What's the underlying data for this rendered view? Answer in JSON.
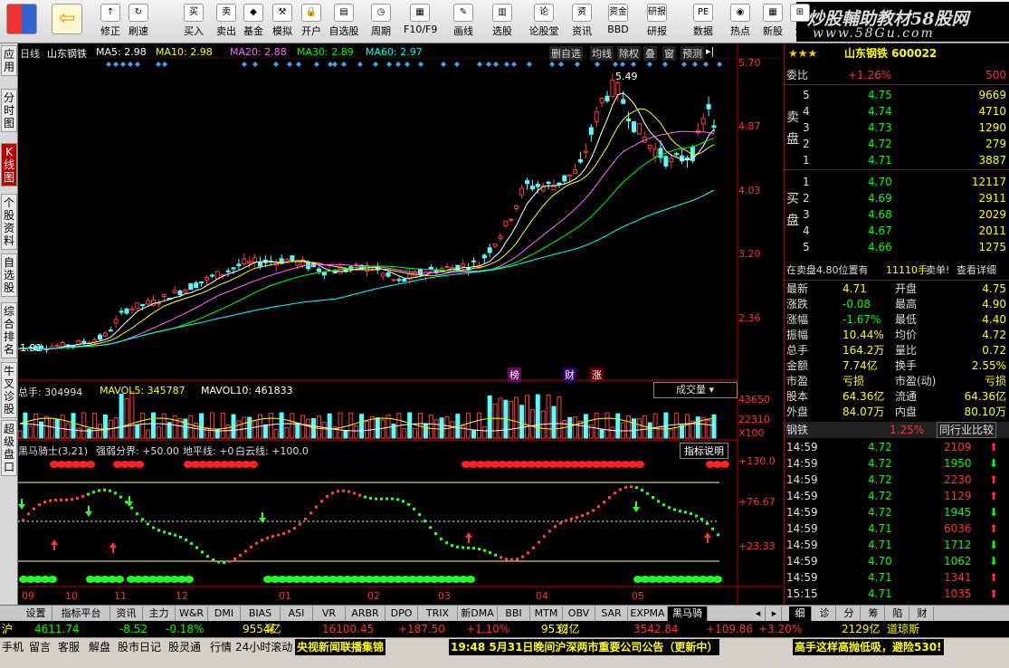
{
  "toolbar": [
    {
      "label": "修正",
      "icon": "↑"
    },
    {
      "label": "刷速",
      "icon": "↻"
    },
    {
      "label": "买入",
      "icon": "买"
    },
    {
      "label": "卖出",
      "icon": "卖"
    },
    {
      "label": "基金",
      "icon": "◆"
    },
    {
      "label": "模拟",
      "icon": "⚒"
    },
    {
      "label": "开户",
      "icon": "🔒"
    },
    {
      "label": "自选股",
      "icon": "▤"
    },
    {
      "label": "周期",
      "icon": "◷"
    },
    {
      "label": "F10/F9",
      "icon": "▦"
    },
    {
      "label": "画线",
      "icon": "✎"
    },
    {
      "label": "选股",
      "icon": "▥"
    },
    {
      "label": "论股堂",
      "icon": "论"
    },
    {
      "label": "资讯",
      "icon": "资"
    },
    {
      "label": "BBD",
      "icon": "资金"
    },
    {
      "label": "研报",
      "icon": "研报"
    },
    {
      "label": "数据",
      "icon": "PE"
    },
    {
      "label": "热点",
      "icon": "◉"
    },
    {
      "label": "新股",
      "icon": "▦"
    },
    {
      "label": "沪",
      "icon": "⊞"
    }
  ],
  "brand": {
    "title": "炒股輔助教材58股网",
    "url": "www.58Gu.com"
  },
  "side_tabs": [
    "应用",
    "分时图",
    "K线图",
    "个股资料",
    "自选股",
    "综合排名",
    "牛叉诊股",
    "超级盘口"
  ],
  "chart": {
    "header": {
      "period": "日线",
      "stock": "山东钢铁",
      "ma5": "MA5: 2.98",
      "ma10": "MA10: 2.98",
      "ma20": "MA20: 2.88",
      "ma30": "MA30: 2.89",
      "ma60": "MA60: 2.97"
    },
    "buttons": [
      "删自选",
      "均线",
      "除权",
      "叠",
      "窗",
      "预测"
    ],
    "price_axis": [
      "5.70",
      "4.87",
      "4.03",
      "3.20",
      "2.36"
    ],
    "high_label": "5.49",
    "low_label": "1.91",
    "markers": [
      "榜",
      "财",
      "涨"
    ],
    "volume": {
      "total": "总手: 304994",
      "mavol5": "MAVOL5: 345787",
      "mavol10": "MAVOL10: 461833",
      "dropdown": "成交量",
      "axis": [
        "43650",
        "22310",
        "X100"
      ]
    },
    "indicator": {
      "name": "黑马骑士(3,21)",
      "line1": "强弱分界: +50.00",
      "line2": "地平线: +0",
      "line3": "白云线: +100.0",
      "help": "指标说明",
      "axis": [
        "+130.0",
        "+76.67",
        "+23.33"
      ]
    },
    "x_months": [
      "09",
      "10",
      "11",
      "12",
      "01",
      "02",
      "03",
      "04",
      "05"
    ]
  },
  "chart_data": {
    "type": "candlestick",
    "title": "山东钢铁 日线",
    "ylim": [
      1.91,
      5.7
    ],
    "x": [
      "09",
      "10",
      "11",
      "12",
      "01",
      "02",
      "03",
      "04",
      "05"
    ],
    "series": [
      {
        "name": "close",
        "values": [
          2.05,
          2.2,
          2.6,
          2.9,
          3.15,
          3.0,
          3.1,
          4.1,
          5.2,
          4.6,
          4.71
        ]
      }
    ]
  },
  "quote": {
    "title": "山东钢铁 600022",
    "webi": {
      "label": "委比",
      "value": "+1.26%",
      "extra": "500"
    },
    "sell_label": "卖盘",
    "buy_label": "买盘",
    "sell": [
      {
        "n": "5",
        "p": "4.75",
        "v": "9669"
      },
      {
        "n": "4",
        "p": "4.74",
        "v": "4710"
      },
      {
        "n": "3",
        "p": "4.73",
        "v": "1290"
      },
      {
        "n": "2",
        "p": "4.72",
        "v": "279"
      },
      {
        "n": "1",
        "p": "4.71",
        "v": "3887"
      }
    ],
    "buy": [
      {
        "n": "1",
        "p": "4.70",
        "v": "12117"
      },
      {
        "n": "2",
        "p": "4.69",
        "v": "2911"
      },
      {
        "n": "3",
        "p": "4.68",
        "v": "2029"
      },
      {
        "n": "4",
        "p": "4.67",
        "v": "2011"
      },
      {
        "n": "5",
        "p": "4.66",
        "v": "1275"
      }
    ],
    "queue": {
      "text": "在卖盘4.80位置有",
      "vol": "11110手",
      "sell": "卖单!",
      "link": "查看详细"
    },
    "stats": [
      [
        "最新",
        "4.71",
        "开盘",
        "4.75"
      ],
      [
        "涨跌",
        "-0.08",
        "最高",
        "4.90"
      ],
      [
        "涨幅",
        "-1.67%",
        "最低",
        "4.40"
      ],
      [
        "振幅",
        "10.44%",
        "均价",
        "4.72"
      ],
      [
        "总手",
        "164.2万",
        "量比",
        "0.72"
      ],
      [
        "金额",
        "7.74亿",
        "换手",
        "2.55%"
      ],
      [
        "市盈",
        "亏损",
        "市盈(动)",
        "亏损"
      ],
      [
        "股本",
        "64.36亿",
        "流通",
        "64.36亿"
      ],
      [
        "外盘",
        "84.07万",
        "内盘",
        "80.10万"
      ]
    ],
    "industry": {
      "name": "钢铁",
      "pct": "1.25%",
      "button": "同行业比较"
    },
    "ticks": [
      [
        "14:59",
        "4.72",
        "2109",
        "up"
      ],
      [
        "14:59",
        "4.72",
        "1950",
        "down"
      ],
      [
        "14:59",
        "4.72",
        "2230",
        "up"
      ],
      [
        "14:59",
        "4.72",
        "1129",
        "up"
      ],
      [
        "14:59",
        "4.72",
        "1945",
        "down"
      ],
      [
        "14:59",
        "4.71",
        "6036",
        "up"
      ],
      [
        "14:59",
        "4.71",
        "1712",
        "down"
      ],
      [
        "14:59",
        "4.70",
        "1062",
        "down"
      ],
      [
        "14:59",
        "4.71",
        "1341",
        "up"
      ],
      [
        "15:15",
        "4.71",
        "1035",
        "up"
      ]
    ]
  },
  "bottom_tabs": [
    "设置",
    "指标平台",
    "资讯",
    "主力",
    "W&R",
    "DMI",
    "BIAS",
    "ASI",
    "VR",
    "ARBR",
    "DPO",
    "TRIX",
    "新DMA",
    "BBI",
    "MTM",
    "OBV",
    "SAR",
    "EXPMA",
    "黑马骑士"
  ],
  "right_tabs": [
    "细",
    "诊",
    "分",
    "筹",
    "陷",
    "财"
  ],
  "index_bar": [
    {
      "name": "沪",
      "val": "4611.74",
      "chg": "-8.52",
      "pct": "-0.18%",
      "amt": "9554亿"
    },
    {
      "name": "深",
      "val": "16100.45",
      "chg": "+187.50",
      "pct": "+1.10%",
      "amt": "9532亿"
    },
    {
      "name": "创",
      "val": "3542.84",
      "chg": "+109.86",
      "pct": "+3.20%",
      "amt": "2129亿"
    },
    {
      "name": "道琼斯"
    }
  ],
  "status_bar": {
    "items": [
      "手机",
      "留言",
      "客服",
      "解盘",
      "股市日记",
      "股灵通",
      "行情",
      "24小时滚动"
    ],
    "news1": "央视新闻联播集锦",
    "news2": "19:48 5月31日晚间沪深两市重要公司公告（更新中）",
    "news3": "高手这样高抛低吸，避险530!"
  },
  "colors": {
    "up": "#ff3c3c",
    "down": "#54ffff",
    "ma5": "#ffffff",
    "ma10": "#ffff00",
    "ma20": "#ff66ff",
    "ma30": "#00ff00",
    "ma60": "#00ffff"
  }
}
